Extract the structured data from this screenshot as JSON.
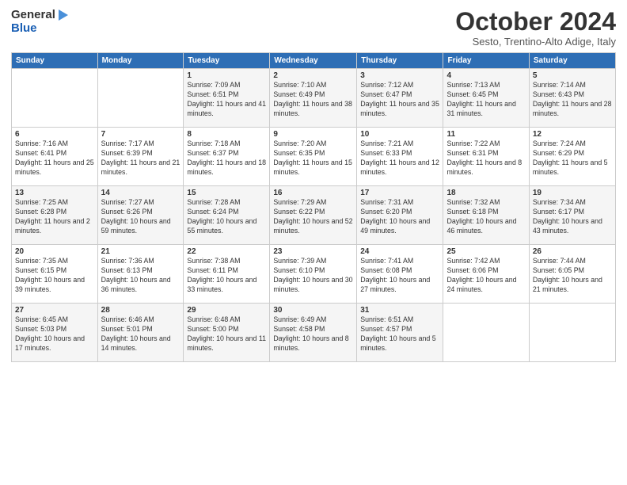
{
  "header": {
    "logo_line1": "General",
    "logo_line2": "Blue",
    "month": "October 2024",
    "location": "Sesto, Trentino-Alto Adige, Italy"
  },
  "days_of_week": [
    "Sunday",
    "Monday",
    "Tuesday",
    "Wednesday",
    "Thursday",
    "Friday",
    "Saturday"
  ],
  "weeks": [
    [
      {
        "num": "",
        "info": ""
      },
      {
        "num": "",
        "info": ""
      },
      {
        "num": "1",
        "info": "Sunrise: 7:09 AM\nSunset: 6:51 PM\nDaylight: 11 hours and 41 minutes."
      },
      {
        "num": "2",
        "info": "Sunrise: 7:10 AM\nSunset: 6:49 PM\nDaylight: 11 hours and 38 minutes."
      },
      {
        "num": "3",
        "info": "Sunrise: 7:12 AM\nSunset: 6:47 PM\nDaylight: 11 hours and 35 minutes."
      },
      {
        "num": "4",
        "info": "Sunrise: 7:13 AM\nSunset: 6:45 PM\nDaylight: 11 hours and 31 minutes."
      },
      {
        "num": "5",
        "info": "Sunrise: 7:14 AM\nSunset: 6:43 PM\nDaylight: 11 hours and 28 minutes."
      }
    ],
    [
      {
        "num": "6",
        "info": "Sunrise: 7:16 AM\nSunset: 6:41 PM\nDaylight: 11 hours and 25 minutes."
      },
      {
        "num": "7",
        "info": "Sunrise: 7:17 AM\nSunset: 6:39 PM\nDaylight: 11 hours and 21 minutes."
      },
      {
        "num": "8",
        "info": "Sunrise: 7:18 AM\nSunset: 6:37 PM\nDaylight: 11 hours and 18 minutes."
      },
      {
        "num": "9",
        "info": "Sunrise: 7:20 AM\nSunset: 6:35 PM\nDaylight: 11 hours and 15 minutes."
      },
      {
        "num": "10",
        "info": "Sunrise: 7:21 AM\nSunset: 6:33 PM\nDaylight: 11 hours and 12 minutes."
      },
      {
        "num": "11",
        "info": "Sunrise: 7:22 AM\nSunset: 6:31 PM\nDaylight: 11 hours and 8 minutes."
      },
      {
        "num": "12",
        "info": "Sunrise: 7:24 AM\nSunset: 6:29 PM\nDaylight: 11 hours and 5 minutes."
      }
    ],
    [
      {
        "num": "13",
        "info": "Sunrise: 7:25 AM\nSunset: 6:28 PM\nDaylight: 11 hours and 2 minutes."
      },
      {
        "num": "14",
        "info": "Sunrise: 7:27 AM\nSunset: 6:26 PM\nDaylight: 10 hours and 59 minutes."
      },
      {
        "num": "15",
        "info": "Sunrise: 7:28 AM\nSunset: 6:24 PM\nDaylight: 10 hours and 55 minutes."
      },
      {
        "num": "16",
        "info": "Sunrise: 7:29 AM\nSunset: 6:22 PM\nDaylight: 10 hours and 52 minutes."
      },
      {
        "num": "17",
        "info": "Sunrise: 7:31 AM\nSunset: 6:20 PM\nDaylight: 10 hours and 49 minutes."
      },
      {
        "num": "18",
        "info": "Sunrise: 7:32 AM\nSunset: 6:18 PM\nDaylight: 10 hours and 46 minutes."
      },
      {
        "num": "19",
        "info": "Sunrise: 7:34 AM\nSunset: 6:17 PM\nDaylight: 10 hours and 43 minutes."
      }
    ],
    [
      {
        "num": "20",
        "info": "Sunrise: 7:35 AM\nSunset: 6:15 PM\nDaylight: 10 hours and 39 minutes."
      },
      {
        "num": "21",
        "info": "Sunrise: 7:36 AM\nSunset: 6:13 PM\nDaylight: 10 hours and 36 minutes."
      },
      {
        "num": "22",
        "info": "Sunrise: 7:38 AM\nSunset: 6:11 PM\nDaylight: 10 hours and 33 minutes."
      },
      {
        "num": "23",
        "info": "Sunrise: 7:39 AM\nSunset: 6:10 PM\nDaylight: 10 hours and 30 minutes."
      },
      {
        "num": "24",
        "info": "Sunrise: 7:41 AM\nSunset: 6:08 PM\nDaylight: 10 hours and 27 minutes."
      },
      {
        "num": "25",
        "info": "Sunrise: 7:42 AM\nSunset: 6:06 PM\nDaylight: 10 hours and 24 minutes."
      },
      {
        "num": "26",
        "info": "Sunrise: 7:44 AM\nSunset: 6:05 PM\nDaylight: 10 hours and 21 minutes."
      }
    ],
    [
      {
        "num": "27",
        "info": "Sunrise: 6:45 AM\nSunset: 5:03 PM\nDaylight: 10 hours and 17 minutes."
      },
      {
        "num": "28",
        "info": "Sunrise: 6:46 AM\nSunset: 5:01 PM\nDaylight: 10 hours and 14 minutes."
      },
      {
        "num": "29",
        "info": "Sunrise: 6:48 AM\nSunset: 5:00 PM\nDaylight: 10 hours and 11 minutes."
      },
      {
        "num": "30",
        "info": "Sunrise: 6:49 AM\nSunset: 4:58 PM\nDaylight: 10 hours and 8 minutes."
      },
      {
        "num": "31",
        "info": "Sunrise: 6:51 AM\nSunset: 4:57 PM\nDaylight: 10 hours and 5 minutes."
      },
      {
        "num": "",
        "info": ""
      },
      {
        "num": "",
        "info": ""
      }
    ]
  ]
}
